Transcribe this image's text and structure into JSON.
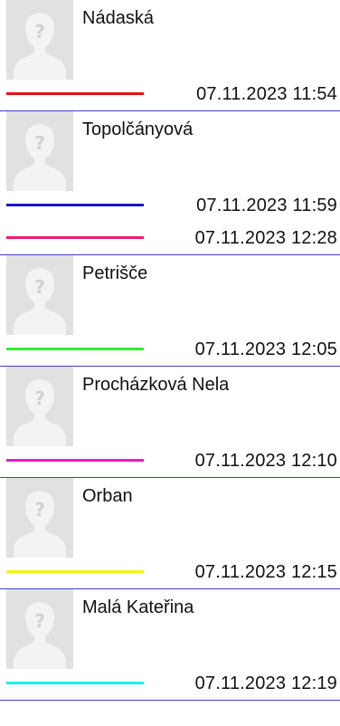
{
  "entries": [
    {
      "name": "Nádaská",
      "tracks": [
        {
          "color": "#e81010",
          "time": "07.11.2023 11:54"
        }
      ]
    },
    {
      "name": "Topolčányová",
      "tracks": [
        {
          "color": "#1818c8",
          "time": "07.11.2023 11:59"
        },
        {
          "color": "#ee1c6e",
          "time": "07.11.2023 12:28"
        }
      ]
    },
    {
      "name": "Petrišče",
      "tracks": [
        {
          "color": "#33ee33",
          "time": "07.11.2023 12:05"
        }
      ]
    },
    {
      "name": "Procházková Nela",
      "tracks": [
        {
          "color": "#e81ac8",
          "time": "07.11.2023 12:10"
        }
      ]
    },
    {
      "name": "Orban",
      "tracks": [
        {
          "color": "#f3f314",
          "time": "07.11.2023 12:15"
        }
      ]
    },
    {
      "name": "Malá Kateřina",
      "tracks": [
        {
          "color": "#1ceeee",
          "time": "07.11.2023 12:19"
        }
      ]
    }
  ]
}
